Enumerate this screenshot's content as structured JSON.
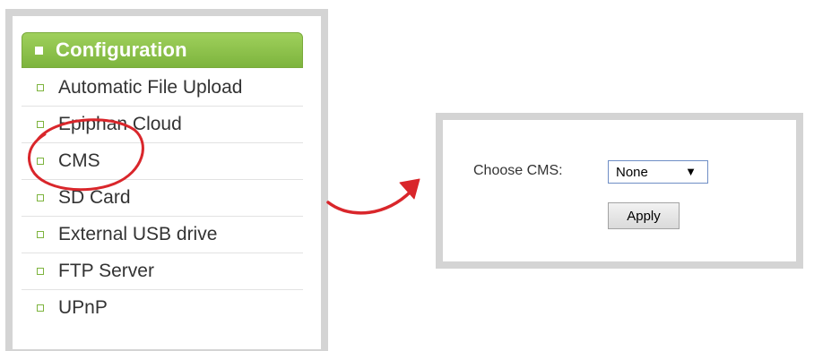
{
  "config_panel": {
    "header": "Configuration",
    "items": [
      {
        "label": "Automatic File Upload"
      },
      {
        "label": "Epiphan Cloud"
      },
      {
        "label": "CMS"
      },
      {
        "label": "SD Card"
      },
      {
        "label": "External USB drive"
      },
      {
        "label": "FTP Server"
      },
      {
        "label": "UPnP"
      }
    ],
    "highlighted_item": "CMS"
  },
  "cms_panel": {
    "label": "Choose CMS:",
    "select_value": "None",
    "apply_label": "Apply"
  },
  "colors": {
    "header_green": "#7db43d",
    "annotation_red": "#d9262b",
    "frame_gray": "#d4d4d4"
  },
  "icons": {
    "dropdown": "▼"
  }
}
